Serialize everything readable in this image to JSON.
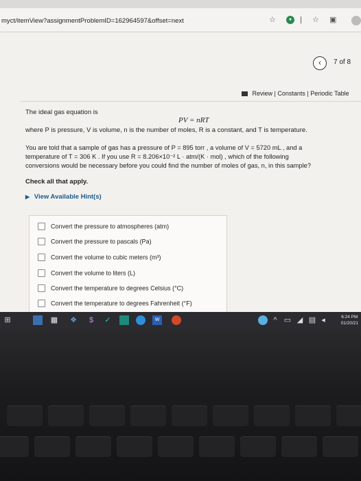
{
  "browser": {
    "url": "myct/itemView?assignmentProblemID=162964597&offset=next"
  },
  "pager": {
    "prev_icon": "‹",
    "text": "7 of 8"
  },
  "toolbar": {
    "links": "Review | Constants | Periodic Table"
  },
  "question": {
    "intro": "The ideal gas equation is",
    "equation": "PV = nRT",
    "definitions": "where P is pressure, V is volume, n is the number of moles, R is a constant, and T is temperature.",
    "para_line1": "You are told that a sample of gas has a pressure of P = 895 torr , a volume of V = 5720 mL , and a",
    "para_line2": "temperature of T = 306 K . If you use R = 8.206×10⁻² L · atm/(K · mol) , which of the following",
    "para_line3": "conversions would be necessary before you could find the number of moles of gas, n, in this sample?",
    "check_all": "Check all that apply.",
    "hints": "View Available Hint(s)"
  },
  "options": [
    {
      "label": "Convert the pressure to atmospheres (atm)"
    },
    {
      "label": "Convert the pressure to pascals (Pa)"
    },
    {
      "label": "Convert the volume to cubic meters (m³)"
    },
    {
      "label": "Convert the volume to liters (L)"
    },
    {
      "label": "Convert the temperature to degrees Celsius (°C)"
    },
    {
      "label": "Convert the temperature to degrees Fahrenheit (°F)"
    }
  ],
  "taskbar": {
    "time": "6:24 PM",
    "date": "01/20/21"
  }
}
